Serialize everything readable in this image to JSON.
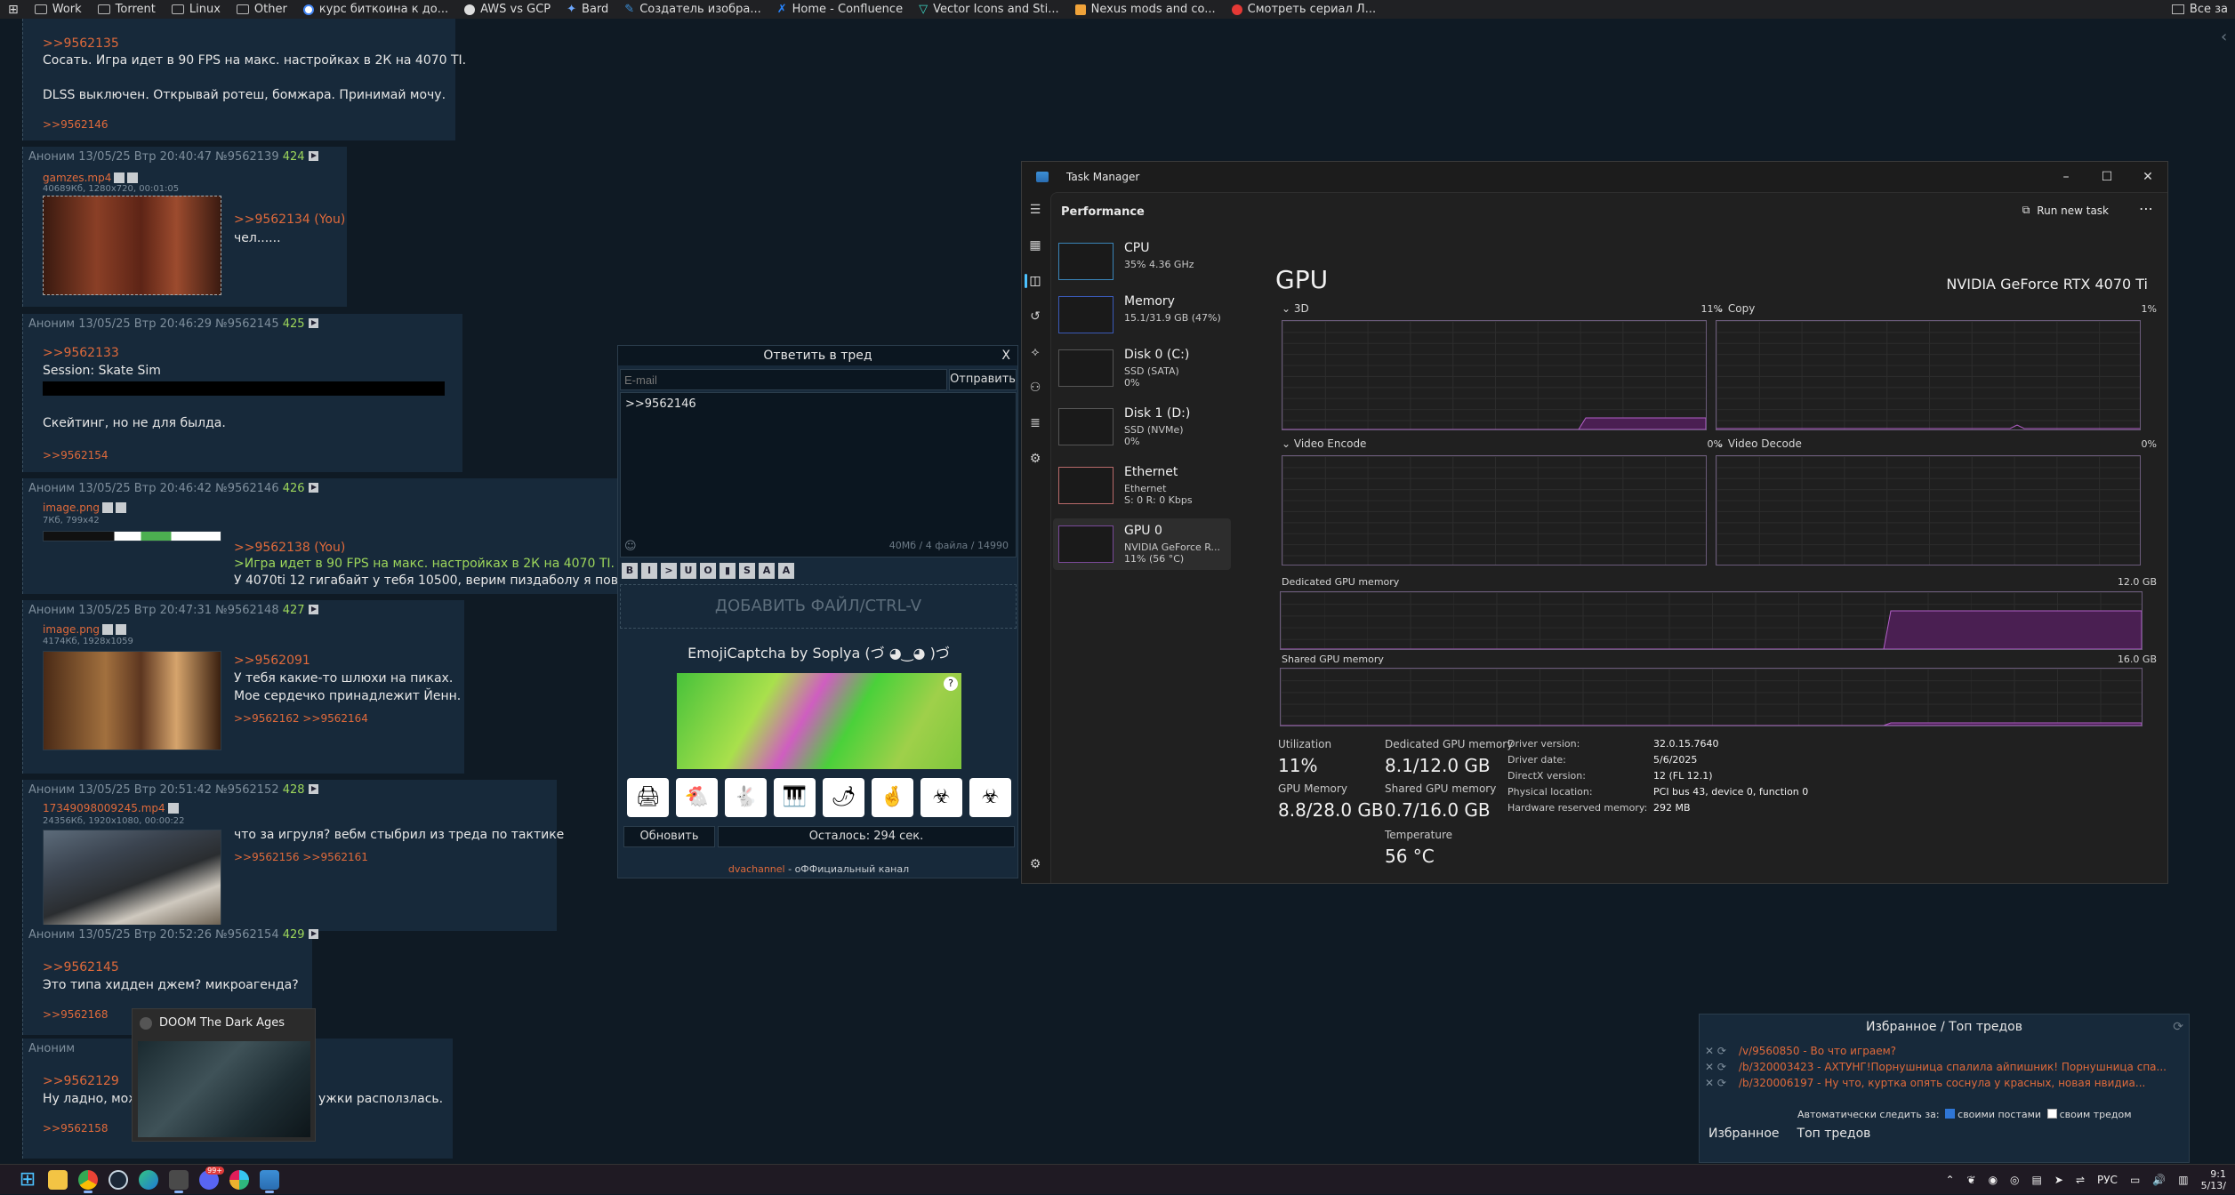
{
  "bookmarks": {
    "items": [
      {
        "label": "Work",
        "icon": "folder-icon"
      },
      {
        "label": "Torrent",
        "icon": "folder-icon"
      },
      {
        "label": "Linux",
        "icon": "folder-icon"
      },
      {
        "label": "Other",
        "icon": "folder-icon"
      },
      {
        "label": "курс биткоина к до...",
        "icon": "google-icon"
      },
      {
        "label": "AWS vs GCP",
        "icon": "chat-icon"
      },
      {
        "label": "Bard",
        "icon": "bard-icon"
      },
      {
        "label": "Создатель изобра...",
        "icon": "bing-icon"
      },
      {
        "label": "Home - Confluence",
        "icon": "confluence-icon"
      },
      {
        "label": "Vector Icons and Sti...",
        "icon": "vector-icon"
      },
      {
        "label": "Nexus mods and co...",
        "icon": "nexus-icon"
      },
      {
        "label": "Смотреть сериал Л...",
        "icon": "video-icon"
      }
    ],
    "all_label": "Все за"
  },
  "posts": [
    {
      "reply": ">>9562135",
      "line1": "Сосать. Игра идет в 90 FPS на макс. настройках в 2К на 4070 TI.",
      "line2": "DLSS выключен. Открывай ротеш, бомжара. Принимай мочу.",
      "replies": ">>9562146"
    },
    {
      "author": "Аноним",
      "date": "13/05/25 Втр 20:40:47",
      "id": "№9562139",
      "num": "424",
      "file": "gamzes.mp4",
      "fileinfo": "40689Кб, 1280x720, 00:01:05",
      "reply": ">>9562134 (You)",
      "text": "чел......"
    },
    {
      "author": "Аноним",
      "date": "13/05/25 Втр 20:46:29",
      "id": "№9562145",
      "num": "425",
      "reply": ">>9562133",
      "line1": "Session: Skate Sim",
      "line2": "Скейтинг, но не для былда.",
      "replies": ">>9562154"
    },
    {
      "author": "Аноним",
      "date": "13/05/25 Втр 20:46:42",
      "id": "№9562146",
      "num": "426",
      "file": "image.png",
      "fileinfo": "7Кб, 799x42",
      "reply": ">>9562138 (You)",
      "green": ">Игра идет в 90 FPS на макс. настройках в 2К на 4070 TI.",
      "text": "У 4070ti 12 гигабайт у тебя 10500, верим пиздаболу я повери"
    },
    {
      "author": "Аноним",
      "date": "13/05/25 Втр 20:47:31",
      "id": "№9562148",
      "num": "427",
      "file": "image.png",
      "fileinfo": "4174Кб, 1928x1059",
      "reply": ">>9562091",
      "line1": "У тебя какие-то шлюхи на пиках.",
      "line2": "Мое сердечко принадлежит Йенн.",
      "replies": ">>9562162 >>9562164"
    },
    {
      "author": "Аноним",
      "date": "13/05/25 Втр 20:51:42",
      "id": "№9562152",
      "num": "428",
      "file": "17349098009245.mp4",
      "fileinfo": "24356Кб, 1920x1080, 00:00:22",
      "text": "что за игруля? вебм стыбрил из треда по тактике",
      "replies": ">>9562156 >>9562161"
    },
    {
      "author": "Аноним",
      "date": "13/05/25 Втр 20:52:26",
      "id": "№9562154",
      "num": "429",
      "reply": ">>9562145",
      "text": "Это типа хидден джем? микроагенда?",
      "replies": ">>9562168"
    },
    {
      "author": "Аноним",
      "reply": ">>9562129",
      "text": "Ну ладно, мож",
      "text_tail": "ужки расползлась.",
      "replies": ">>9562158"
    }
  ],
  "reply_form": {
    "title": "Ответить в тред",
    "close": "X",
    "email_placeholder": "E-mail",
    "send": "Отправить",
    "message": ">>9562146",
    "counter": "40Мб / 4 файла / 14990",
    "format_buttons": [
      "B",
      "I",
      ">",
      "U",
      "O",
      "▮",
      "S",
      "A",
      "A"
    ],
    "drop": "ДОБАВИТЬ ФАЙЛ/CTRL-V",
    "captcha_title": "EmojiCaptcha by Soplya (づ ◕‿◕ )づ",
    "captcha_help": "?",
    "emoji": [
      "🖨",
      "🐔",
      "🐇",
      "🎹",
      "🌶",
      "🤞",
      "☣",
      "☣"
    ],
    "refresh": "Обновить",
    "remaining": "Осталось: 294 сек.",
    "footer_link": "dvachannel",
    "footer_text": " - оФФициальный канал"
  },
  "task_manager": {
    "title": "Task Manager",
    "section": "Performance",
    "run_new_task": "Run new task",
    "more": "⋯",
    "resources": [
      {
        "name": "CPU",
        "sub1": "35%  4.36 GHz",
        "sub2": ""
      },
      {
        "name": "Memory",
        "sub1": "15.1/31.9 GB (47%)",
        "sub2": ""
      },
      {
        "name": "Disk 0 (C:)",
        "sub1": "SSD (SATA)",
        "sub2": "0%"
      },
      {
        "name": "Disk 1 (D:)",
        "sub1": "SSD (NVMe)",
        "sub2": "0%"
      },
      {
        "name": "Ethernet",
        "sub1": "Ethernet",
        "sub2": "S: 0  R: 0 Kbps"
      },
      {
        "name": "GPU 0",
        "sub1": "NVIDIA GeForce R...",
        "sub2": "11% (56 °C)"
      }
    ],
    "heading": "GPU",
    "gpu_name": "NVIDIA GeForce RTX 4070 Ti",
    "graphs": [
      {
        "label": "3D",
        "pct": "11%"
      },
      {
        "label": "Copy",
        "pct": "1%"
      },
      {
        "label": "Video Encode",
        "pct": "0%"
      },
      {
        "label": "Video Decode",
        "pct": "0%"
      }
    ],
    "dedicated_label": "Dedicated GPU memory",
    "dedicated_max": "12.0 GB",
    "shared_label": "Shared GPU memory",
    "shared_max": "16.0 GB",
    "stats": {
      "utilization_label": "Utilization",
      "utilization": "11%",
      "gpu_memory_label": "GPU Memory",
      "gpu_memory": "8.8/28.0 GB",
      "dedicated_label": "Dedicated GPU memory",
      "dedicated": "8.1/12.0 GB",
      "shared_label": "Shared GPU memory",
      "shared": "0.7/16.0 GB",
      "temp_label": "Temperature",
      "temp": "56 °C"
    },
    "info": [
      {
        "k": "Driver version:",
        "v": "32.0.15.7640"
      },
      {
        "k": "Driver date:",
        "v": "5/6/2025"
      },
      {
        "k": "DirectX version:",
        "v": "12 (FL 12.1)"
      },
      {
        "k": "Physical location:",
        "v": "PCI bus 43, device 0, function 0"
      },
      {
        "k": "Hardware reserved memory:",
        "v": "292 MB"
      }
    ],
    "usage": {
      "3d": 0.11,
      "dedicated": 0.675,
      "shared": 0.044
    }
  },
  "favorites": {
    "title": "Избранное / Топ тредов",
    "rows": [
      "/v/9560850 - Во что играем?",
      "/b/320003423 - АХТУНГ!Порнушница спалила айпишник! Порнушница спа...",
      "/b/320006197 - Ну что, куртка опять соснула у красных, новая нвидиа..."
    ],
    "auto_label": "Автоматически следить за:",
    "own_posts": "своими постами",
    "own_thread": "своим тредом",
    "tab1": "Избранное",
    "tab2": "Топ тредов"
  },
  "preview": {
    "title": "DOOM The Dark Ages"
  },
  "taskbar": {
    "lang": "РУС",
    "time": "9:1",
    "date": "5/13/",
    "badge": "99+"
  }
}
